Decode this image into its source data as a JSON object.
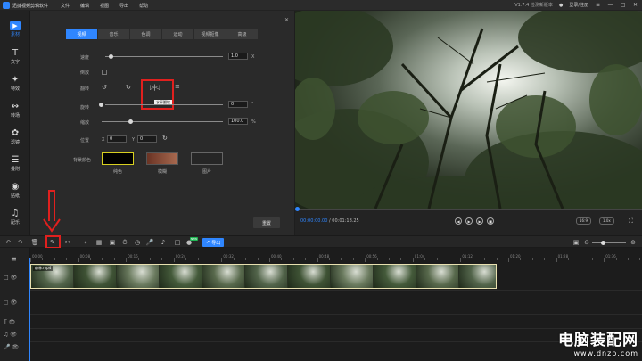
{
  "titlebar": {
    "app_title": "迅捷视频剪辑软件",
    "menu": [
      "文件",
      "编辑",
      "视图",
      "导出",
      "帮助"
    ],
    "version": "V1.7.4 检测新版本",
    "login": "登录/注册"
  },
  "sidebar": {
    "items": [
      {
        "label": "素材",
        "icon": "media-icon"
      },
      {
        "label": "文字",
        "icon": "text-icon"
      },
      {
        "label": "特效",
        "icon": "effects-icon"
      },
      {
        "label": "转场",
        "icon": "transition-icon"
      },
      {
        "label": "滤镜",
        "icon": "filter-icon"
      },
      {
        "label": "叠附",
        "icon": "overlay-icon"
      },
      {
        "label": "贴纸",
        "icon": "sticker-icon"
      },
      {
        "label": "配乐",
        "icon": "music-icon"
      }
    ]
  },
  "panel": {
    "tabs": [
      "视频",
      "音乐",
      "色调",
      "运动",
      "视频抠像",
      "高级"
    ],
    "rows": {
      "speed_label": "速度",
      "speed_value": "1.0",
      "speed_unit": "X",
      "speed_fraction": 0.0,
      "reverse_label": "倒放",
      "flip_label": "翻转",
      "rotate_label": "旋转",
      "rotate_value": "0",
      "rotate_unit": "°",
      "scale_label": "缩放",
      "scale_value": "100.0",
      "scale_unit": "%",
      "position_label": "位置",
      "pos_x_label": "X",
      "pos_x_value": "0",
      "pos_y_label": "Y",
      "pos_y_value": "0",
      "bg_label": "背景颜色"
    },
    "tooltip": "水平翻转",
    "bg_options": [
      {
        "label": "纯色",
        "color": "#000000"
      },
      {
        "label": "模糊"
      },
      {
        "label": "图片"
      }
    ],
    "reset_label": "重置"
  },
  "player": {
    "time_current": "00:00:00.00",
    "time_total": "00:01:18.25",
    "aspect": "16:9",
    "zoom": "1.0x",
    "progress_fraction": 0.0
  },
  "toolbar": {
    "export_label": "导出",
    "new_badge": "NEW"
  },
  "timeline": {
    "ruler": [
      "00:00",
      "00:08",
      "00:16",
      "00:24",
      "00:32",
      "00:40",
      "00:48",
      "00:56",
      "01:04",
      "01:12",
      "01:20",
      "01:28",
      "01:36"
    ],
    "clip_label": "森林.mp4"
  },
  "watermark": {
    "big": "电脑装配网",
    "small": "www.dnzp.com"
  }
}
